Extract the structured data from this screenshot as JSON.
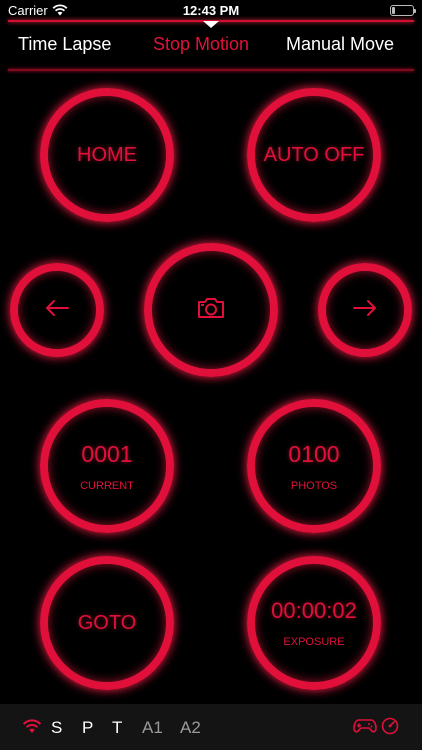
{
  "status_bar": {
    "carrier": "Carrier",
    "time": "12:43 PM",
    "battery_level": 0.15
  },
  "tabs": [
    {
      "label": "Time Lapse",
      "active": false
    },
    {
      "label": "Stop Motion",
      "active": true
    },
    {
      "label": "Manual Move",
      "active": false
    }
  ],
  "buttons": {
    "home": {
      "label": "HOME"
    },
    "auto_off": {
      "label": "AUTO OFF"
    },
    "prev": {
      "icon": "arrow-left-icon"
    },
    "shutter": {
      "icon": "camera-icon"
    },
    "next": {
      "icon": "arrow-right-icon"
    },
    "current": {
      "value": "0001",
      "label": "CURRENT"
    },
    "photos": {
      "value": "0100",
      "label": "PHOTOS"
    },
    "goto": {
      "label": "GOTO"
    },
    "exposure": {
      "value": "00:00:02",
      "label": "EXPOSURE"
    }
  },
  "bottom_bar": {
    "items": [
      "S",
      "P",
      "T",
      "A1",
      "A2"
    ],
    "icons": [
      "wifi-icon",
      "gamepad-icon",
      "speedometer-icon"
    ]
  },
  "colors": {
    "accent": "#e0103a",
    "background": "#000000",
    "bottom_bar": "#141414"
  }
}
